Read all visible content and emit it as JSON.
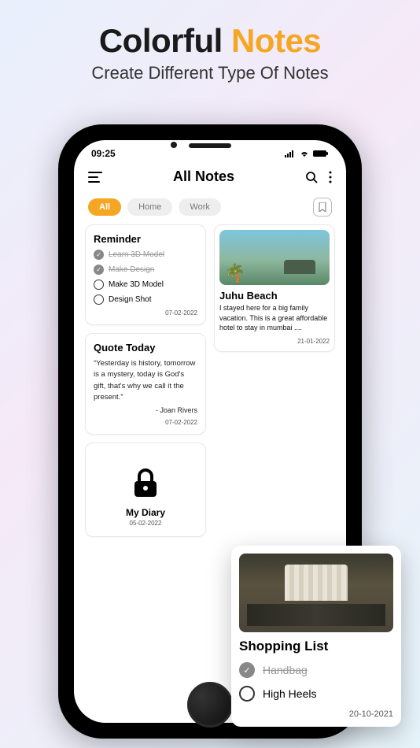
{
  "promo": {
    "title_part1": "Colorful ",
    "title_part2": "Notes",
    "subtitle": "Create Different Type Of Notes"
  },
  "status": {
    "time": "09:25"
  },
  "header": {
    "title": "All Notes"
  },
  "tabs": {
    "items": [
      {
        "label": "All",
        "active": true
      },
      {
        "label": "Home",
        "active": false
      },
      {
        "label": "Work",
        "active": false
      }
    ]
  },
  "reminder": {
    "title": "Reminder",
    "items": [
      {
        "label": "Learn 3D Model",
        "done": true
      },
      {
        "label": "Make Design",
        "done": true
      },
      {
        "label": "Make 3D Model",
        "done": false
      },
      {
        "label": "Design Shot",
        "done": false
      }
    ],
    "date": "07-02-2022"
  },
  "quote": {
    "title": "Quote Today",
    "text": "“Yesterday is history, tomorrow is a mystery, today is God's gift, that's why we call it the present.”",
    "author": "- Joan Rivers",
    "date": "07-02-2022"
  },
  "diary": {
    "title": "My Diary",
    "date": "05-02-2022"
  },
  "beach": {
    "title": "Juhu Beach",
    "desc": "I stayed here for a big family vacation. This is a great affordable hotel to stay in mumbai ....",
    "date": "21-01-2022"
  },
  "shopping": {
    "title": "Shopping List",
    "items": [
      {
        "label": "Handbag",
        "done": true
      },
      {
        "label": "High Heels",
        "done": false
      }
    ],
    "date": "20-10-2021"
  }
}
